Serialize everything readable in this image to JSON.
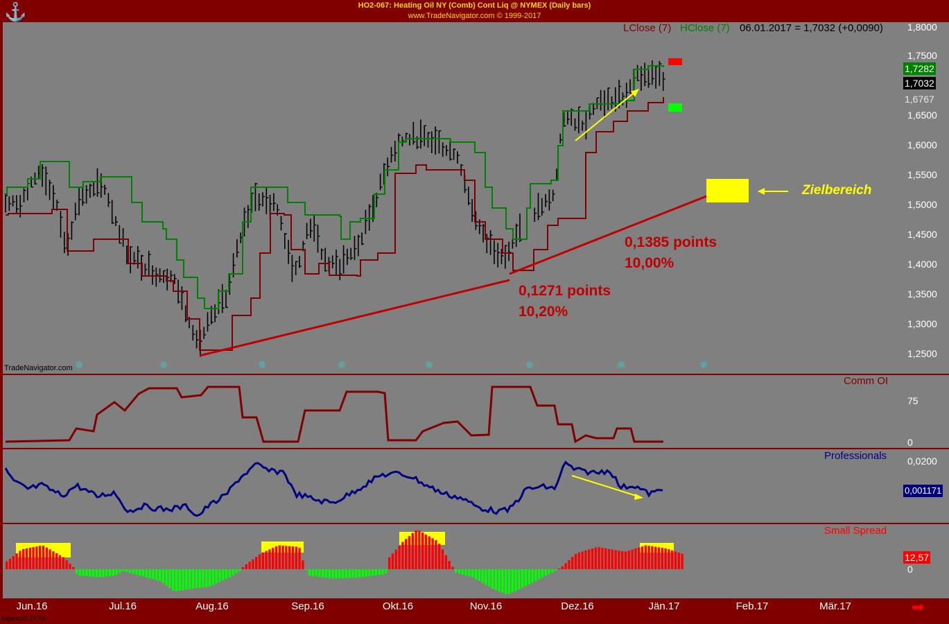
{
  "header": {
    "title": "HO2-067: Heating Oil NY (Comb) Cont Liq @ NYMEX  (Daily bars)",
    "subtitle": "www.TradeNavigator.com © 1999-2017"
  },
  "watermark": "TradeNavigator.com",
  "footer_note": "Eigentum ZYXA",
  "price_panel": {
    "legend_lclose": "LClose (7)",
    "legend_hclose": "HClose (7)",
    "readout": "06.01.2017 = 1,7032 (+0,0090)",
    "last_hclose": "1,7282",
    "last_close": "1,7032",
    "last_lclose": "1,6767",
    "annotation_target": "Zielbereich",
    "annotation_1_points": "0,1271 points",
    "annotation_1_pct": "10,20%",
    "annotation_2_points": "0,1385 points",
    "annotation_2_pct": "10,00%",
    "yticks": [
      "1,8000",
      "1,7500",
      "1,6500",
      "1,6000",
      "1,5500",
      "1,5000",
      "1,4500",
      "1,4000",
      "1,3500",
      "1,3000",
      "1,2500"
    ]
  },
  "comm_panel": {
    "label": "Comm OI",
    "yticks": [
      "75",
      "0"
    ]
  },
  "prof_panel": {
    "label": "Professionals",
    "yticks": [
      "0,0200"
    ],
    "last_value": "0,001171"
  },
  "spread_panel": {
    "label": "Small Spread",
    "yticks": [
      "0"
    ],
    "last_value": "12,57"
  },
  "x_axis": {
    "labels": [
      "Jun.16",
      "Jul.16",
      "Aug.16",
      "Sep.16",
      "Okt.16",
      "Nov.16",
      "Dez.16",
      "Jän.17",
      "Feb.17",
      "Mär.17"
    ]
  },
  "colors": {
    "frame": "#800000",
    "panel_bg": "#808080",
    "bars": "#000000",
    "hclose": "#008000",
    "lclose": "#800000",
    "professionals": "#000080",
    "spread_pos": "#ff0000",
    "spread_neg": "#00ff00",
    "highlight": "#ffff00",
    "trendline": "#c00000"
  },
  "chart_data": [
    {
      "type": "line",
      "title": "HO2-067: Heating Oil NY (Comb) Cont Liq @ NYMEX  (Daily bars)",
      "x": [
        "Jun.16",
        "Jul.16",
        "Aug.16",
        "Sep.16",
        "Okt.16",
        "Nov.16",
        "Dez.16",
        "Jän.17"
      ],
      "ylim": [
        1.23,
        1.81
      ],
      "series": [
        {
          "name": "HClose (7)",
          "values": [
            1.515,
            1.545,
            1.26,
            1.53,
            1.61,
            1.44,
            1.655,
            1.728
          ]
        },
        {
          "name": "LClose (7)",
          "values": [
            1.49,
            1.445,
            1.255,
            1.47,
            1.58,
            1.385,
            1.62,
            1.677
          ]
        }
      ],
      "close_approx": [
        1.5,
        1.5,
        1.28,
        1.51,
        1.6,
        1.41,
        1.64,
        1.7032
      ],
      "trendlines": [
        {
          "from": [
            "Aug.16",
            1.25
          ],
          "to": [
            "Nov.16",
            1.377
          ]
        },
        {
          "from": [
            "Nov.16",
            1.377
          ],
          "to": [
            "Jan.17",
            1.525
          ]
        }
      ]
    },
    {
      "type": "line",
      "title": "Comm OI",
      "x": [
        "Jun.16",
        "Jul.16",
        "Aug.16",
        "Sep.16",
        "Okt.16",
        "Nov.16",
        "Dez.16",
        "Jän.17"
      ],
      "series": [
        {
          "name": "Comm OI",
          "values": [
            0,
            60,
            95,
            0,
            85,
            5,
            95,
            0
          ]
        }
      ]
    },
    {
      "type": "line",
      "title": "Professionals",
      "x": [
        "Jun.16",
        "Jul.16",
        "Aug.16",
        "Sep.16",
        "Okt.16",
        "Nov.16",
        "Dez.16",
        "Jän.17"
      ],
      "series": [
        {
          "name": "Professionals",
          "values": [
            0.008,
            0.0,
            -0.005,
            0.015,
            0.014,
            -0.006,
            0.022,
            0.001171
          ]
        }
      ]
    },
    {
      "type": "bar",
      "title": "Small Spread",
      "x": [
        "Jun.16",
        "Jul.16",
        "Aug.16",
        "Sep.16",
        "Okt.16",
        "Nov.16",
        "Dez.16",
        "Jän.17"
      ],
      "series": [
        {
          "name": "Small Spread",
          "values": [
            25,
            -8,
            -25,
            30,
            -10,
            -30,
            25,
            12.57
          ]
        }
      ]
    }
  ]
}
